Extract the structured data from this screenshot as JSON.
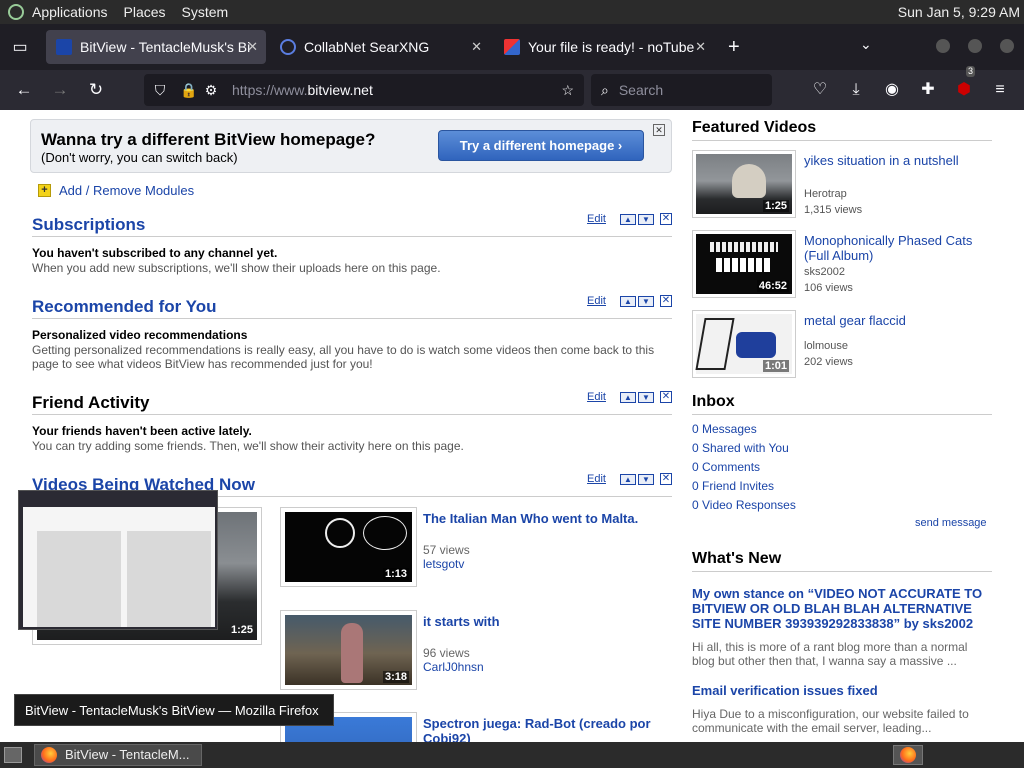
{
  "system_bar": {
    "menus": [
      "Applications",
      "Places",
      "System"
    ],
    "clock": "Sun Jan  5,  9:29 AM"
  },
  "tabs": [
    {
      "title": "BitView - TentacleMusk's Bi",
      "active": true
    },
    {
      "title": "CollabNet SearXNG",
      "active": false
    },
    {
      "title": "Your file is ready! - noTube",
      "active": false
    }
  ],
  "toolbar": {
    "url_prefix": "https://www.",
    "url_domain": "bitview.net",
    "search_placeholder": "Search",
    "extension_badge": "3"
  },
  "banner": {
    "title": "Wanna try a different BitView homepage?",
    "subtitle": "(Don't worry, you can switch back)",
    "button": "Try a different homepage ›"
  },
  "add_modules": "Add / Remove Modules",
  "modules": {
    "edit_label": "Edit",
    "subscriptions": {
      "title": "Subscriptions",
      "bold": "You haven't subscribed to any channel yet.",
      "text": "When you add new subscriptions, we'll show their uploads here on this page."
    },
    "recommended": {
      "title": "Recommended for You",
      "bold": "Personalized video recommendations",
      "text": "Getting personalized recommendations is really easy, all you have to do is watch some videos then come back to this page to see what videos BitView has recommended just for you!"
    },
    "friends": {
      "title": "Friend Activity",
      "bold": "Your friends haven't been active lately.",
      "text": "You can try adding some friends. Then, we'll show their activity here on this page."
    },
    "watched": {
      "title": "Videos Being Watched Now"
    }
  },
  "watched_now": {
    "big_duration": "1:25",
    "items": [
      {
        "title": "The Italian Man Who went to Malta.",
        "views": "57 views",
        "user": "letsgotv",
        "duration": "1:13"
      },
      {
        "title": "it starts with",
        "views": "96 views",
        "user": "CarlJ0hnsn",
        "duration": "3:18"
      },
      {
        "title": "Spectron juega: Rad-Bot (creado por Cobi92)",
        "views": "",
        "user": "",
        "duration": ""
      }
    ]
  },
  "featured": {
    "title": "Featured Videos",
    "items": [
      {
        "title": "yikes situation in a nutshell",
        "user": "Herotrap",
        "views": "1,315 views",
        "duration": "1:25"
      },
      {
        "title": "Monophonically Phased Cats (Full Album)",
        "user": "sks2002",
        "views": "106 views",
        "duration": "46:52"
      },
      {
        "title": "metal gear flaccid",
        "user": "lolmouse",
        "views": "202 views",
        "duration": "1:01"
      }
    ]
  },
  "inbox": {
    "title": "Inbox",
    "links": [
      "0 Messages",
      "0 Shared with You",
      "0 Comments",
      "0 Friend Invites",
      "0 Video Responses"
    ],
    "send": "send message"
  },
  "whats_new": {
    "title": "What's New",
    "posts": [
      {
        "title": "My own stance on “VIDEO NOT ACCURATE TO BITVIEW OR OLD BLAH BLAH ALTERNATIVE SITE NUMBER 393939292833838” by sks2002",
        "body": "Hi all, this is more of a rant blog more than a normal blog but other then that, I wanna say a massive ..."
      },
      {
        "title": "Email verification issues fixed",
        "body": "Hiya Due to a misconfiguration, our website failed to communicate with the email server, leading..."
      }
    ]
  },
  "tooltip": "BitView - TentacleMusk's BitView — Mozilla Firefox",
  "taskbar": {
    "window": "BitView - TentacleM..."
  }
}
